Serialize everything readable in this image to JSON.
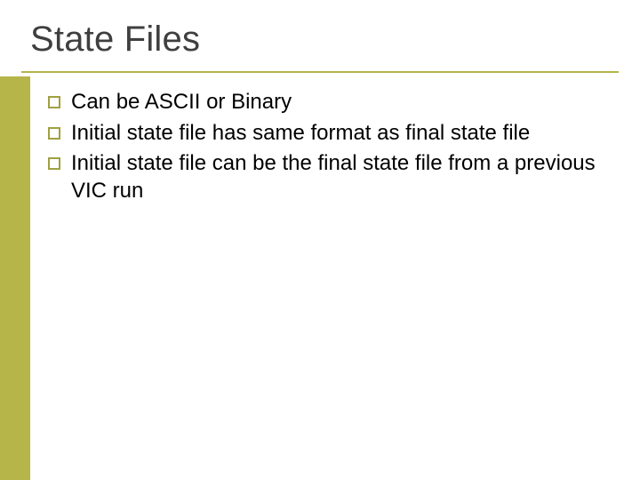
{
  "slide": {
    "title": "State Files",
    "bullets": [
      "Can be ASCII or Binary",
      "Initial state file has same format as final state file",
      "Initial state file can be the final state file from a previous VIC run"
    ]
  }
}
